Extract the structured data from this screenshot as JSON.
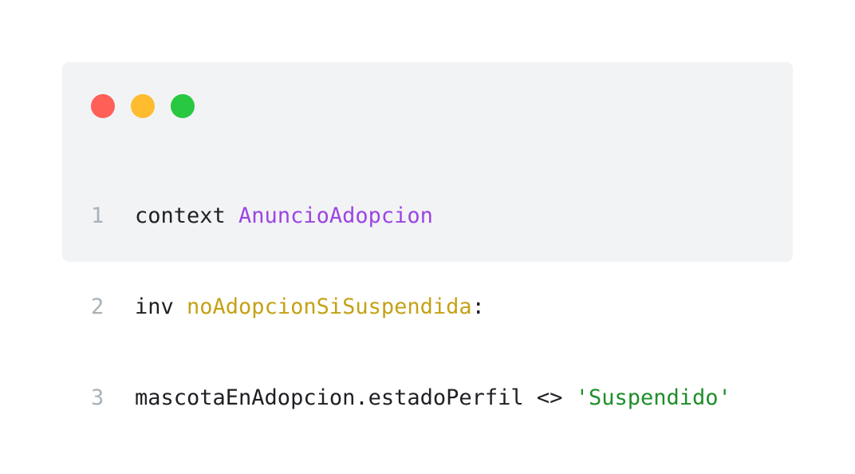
{
  "window": {
    "controls": [
      {
        "name": "close",
        "color": "#ff5f57"
      },
      {
        "name": "minimize",
        "color": "#febc2e"
      },
      {
        "name": "maximize",
        "color": "#28c840"
      }
    ]
  },
  "code": {
    "lines": [
      {
        "number": "1",
        "tokens": [
          {
            "text": "context ",
            "type": "default"
          },
          {
            "text": "AnuncioAdopcion",
            "type": "class"
          }
        ]
      },
      {
        "number": "2",
        "tokens": [
          {
            "text": "inv ",
            "type": "default"
          },
          {
            "text": "noAdopcionSiSuspendida",
            "type": "name"
          },
          {
            "text": ":",
            "type": "default"
          }
        ]
      },
      {
        "number": "3",
        "tokens": [
          {
            "text": "mascotaEnAdopcion.estadoPerfil <> ",
            "type": "default"
          },
          {
            "text": "'Suspendido'",
            "type": "string"
          }
        ]
      }
    ]
  }
}
